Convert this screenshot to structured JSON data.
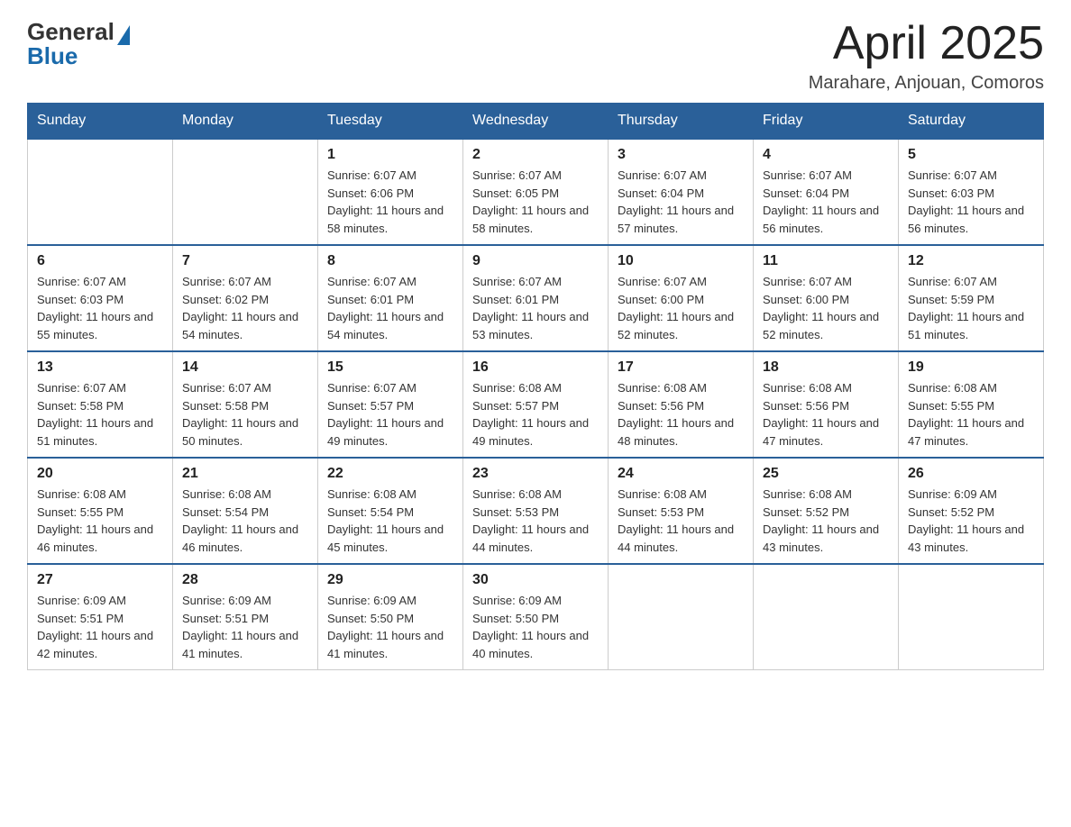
{
  "header": {
    "logo_general": "General",
    "logo_blue": "Blue",
    "title": "April 2025",
    "location": "Marahare, Anjouan, Comoros"
  },
  "weekdays": [
    "Sunday",
    "Monday",
    "Tuesday",
    "Wednesday",
    "Thursday",
    "Friday",
    "Saturday"
  ],
  "weeks": [
    [
      {
        "day": "",
        "sunrise": "",
        "sunset": "",
        "daylight": ""
      },
      {
        "day": "",
        "sunrise": "",
        "sunset": "",
        "daylight": ""
      },
      {
        "day": "1",
        "sunrise": "Sunrise: 6:07 AM",
        "sunset": "Sunset: 6:06 PM",
        "daylight": "Daylight: 11 hours and 58 minutes."
      },
      {
        "day": "2",
        "sunrise": "Sunrise: 6:07 AM",
        "sunset": "Sunset: 6:05 PM",
        "daylight": "Daylight: 11 hours and 58 minutes."
      },
      {
        "day": "3",
        "sunrise": "Sunrise: 6:07 AM",
        "sunset": "Sunset: 6:04 PM",
        "daylight": "Daylight: 11 hours and 57 minutes."
      },
      {
        "day": "4",
        "sunrise": "Sunrise: 6:07 AM",
        "sunset": "Sunset: 6:04 PM",
        "daylight": "Daylight: 11 hours and 56 minutes."
      },
      {
        "day": "5",
        "sunrise": "Sunrise: 6:07 AM",
        "sunset": "Sunset: 6:03 PM",
        "daylight": "Daylight: 11 hours and 56 minutes."
      }
    ],
    [
      {
        "day": "6",
        "sunrise": "Sunrise: 6:07 AM",
        "sunset": "Sunset: 6:03 PM",
        "daylight": "Daylight: 11 hours and 55 minutes."
      },
      {
        "day": "7",
        "sunrise": "Sunrise: 6:07 AM",
        "sunset": "Sunset: 6:02 PM",
        "daylight": "Daylight: 11 hours and 54 minutes."
      },
      {
        "day": "8",
        "sunrise": "Sunrise: 6:07 AM",
        "sunset": "Sunset: 6:01 PM",
        "daylight": "Daylight: 11 hours and 54 minutes."
      },
      {
        "day": "9",
        "sunrise": "Sunrise: 6:07 AM",
        "sunset": "Sunset: 6:01 PM",
        "daylight": "Daylight: 11 hours and 53 minutes."
      },
      {
        "day": "10",
        "sunrise": "Sunrise: 6:07 AM",
        "sunset": "Sunset: 6:00 PM",
        "daylight": "Daylight: 11 hours and 52 minutes."
      },
      {
        "day": "11",
        "sunrise": "Sunrise: 6:07 AM",
        "sunset": "Sunset: 6:00 PM",
        "daylight": "Daylight: 11 hours and 52 minutes."
      },
      {
        "day": "12",
        "sunrise": "Sunrise: 6:07 AM",
        "sunset": "Sunset: 5:59 PM",
        "daylight": "Daylight: 11 hours and 51 minutes."
      }
    ],
    [
      {
        "day": "13",
        "sunrise": "Sunrise: 6:07 AM",
        "sunset": "Sunset: 5:58 PM",
        "daylight": "Daylight: 11 hours and 51 minutes."
      },
      {
        "day": "14",
        "sunrise": "Sunrise: 6:07 AM",
        "sunset": "Sunset: 5:58 PM",
        "daylight": "Daylight: 11 hours and 50 minutes."
      },
      {
        "day": "15",
        "sunrise": "Sunrise: 6:07 AM",
        "sunset": "Sunset: 5:57 PM",
        "daylight": "Daylight: 11 hours and 49 minutes."
      },
      {
        "day": "16",
        "sunrise": "Sunrise: 6:08 AM",
        "sunset": "Sunset: 5:57 PM",
        "daylight": "Daylight: 11 hours and 49 minutes."
      },
      {
        "day": "17",
        "sunrise": "Sunrise: 6:08 AM",
        "sunset": "Sunset: 5:56 PM",
        "daylight": "Daylight: 11 hours and 48 minutes."
      },
      {
        "day": "18",
        "sunrise": "Sunrise: 6:08 AM",
        "sunset": "Sunset: 5:56 PM",
        "daylight": "Daylight: 11 hours and 47 minutes."
      },
      {
        "day": "19",
        "sunrise": "Sunrise: 6:08 AM",
        "sunset": "Sunset: 5:55 PM",
        "daylight": "Daylight: 11 hours and 47 minutes."
      }
    ],
    [
      {
        "day": "20",
        "sunrise": "Sunrise: 6:08 AM",
        "sunset": "Sunset: 5:55 PM",
        "daylight": "Daylight: 11 hours and 46 minutes."
      },
      {
        "day": "21",
        "sunrise": "Sunrise: 6:08 AM",
        "sunset": "Sunset: 5:54 PM",
        "daylight": "Daylight: 11 hours and 46 minutes."
      },
      {
        "day": "22",
        "sunrise": "Sunrise: 6:08 AM",
        "sunset": "Sunset: 5:54 PM",
        "daylight": "Daylight: 11 hours and 45 minutes."
      },
      {
        "day": "23",
        "sunrise": "Sunrise: 6:08 AM",
        "sunset": "Sunset: 5:53 PM",
        "daylight": "Daylight: 11 hours and 44 minutes."
      },
      {
        "day": "24",
        "sunrise": "Sunrise: 6:08 AM",
        "sunset": "Sunset: 5:53 PM",
        "daylight": "Daylight: 11 hours and 44 minutes."
      },
      {
        "day": "25",
        "sunrise": "Sunrise: 6:08 AM",
        "sunset": "Sunset: 5:52 PM",
        "daylight": "Daylight: 11 hours and 43 minutes."
      },
      {
        "day": "26",
        "sunrise": "Sunrise: 6:09 AM",
        "sunset": "Sunset: 5:52 PM",
        "daylight": "Daylight: 11 hours and 43 minutes."
      }
    ],
    [
      {
        "day": "27",
        "sunrise": "Sunrise: 6:09 AM",
        "sunset": "Sunset: 5:51 PM",
        "daylight": "Daylight: 11 hours and 42 minutes."
      },
      {
        "day": "28",
        "sunrise": "Sunrise: 6:09 AM",
        "sunset": "Sunset: 5:51 PM",
        "daylight": "Daylight: 11 hours and 41 minutes."
      },
      {
        "day": "29",
        "sunrise": "Sunrise: 6:09 AM",
        "sunset": "Sunset: 5:50 PM",
        "daylight": "Daylight: 11 hours and 41 minutes."
      },
      {
        "day": "30",
        "sunrise": "Sunrise: 6:09 AM",
        "sunset": "Sunset: 5:50 PM",
        "daylight": "Daylight: 11 hours and 40 minutes."
      },
      {
        "day": "",
        "sunrise": "",
        "sunset": "",
        "daylight": ""
      },
      {
        "day": "",
        "sunrise": "",
        "sunset": "",
        "daylight": ""
      },
      {
        "day": "",
        "sunrise": "",
        "sunset": "",
        "daylight": ""
      }
    ]
  ]
}
